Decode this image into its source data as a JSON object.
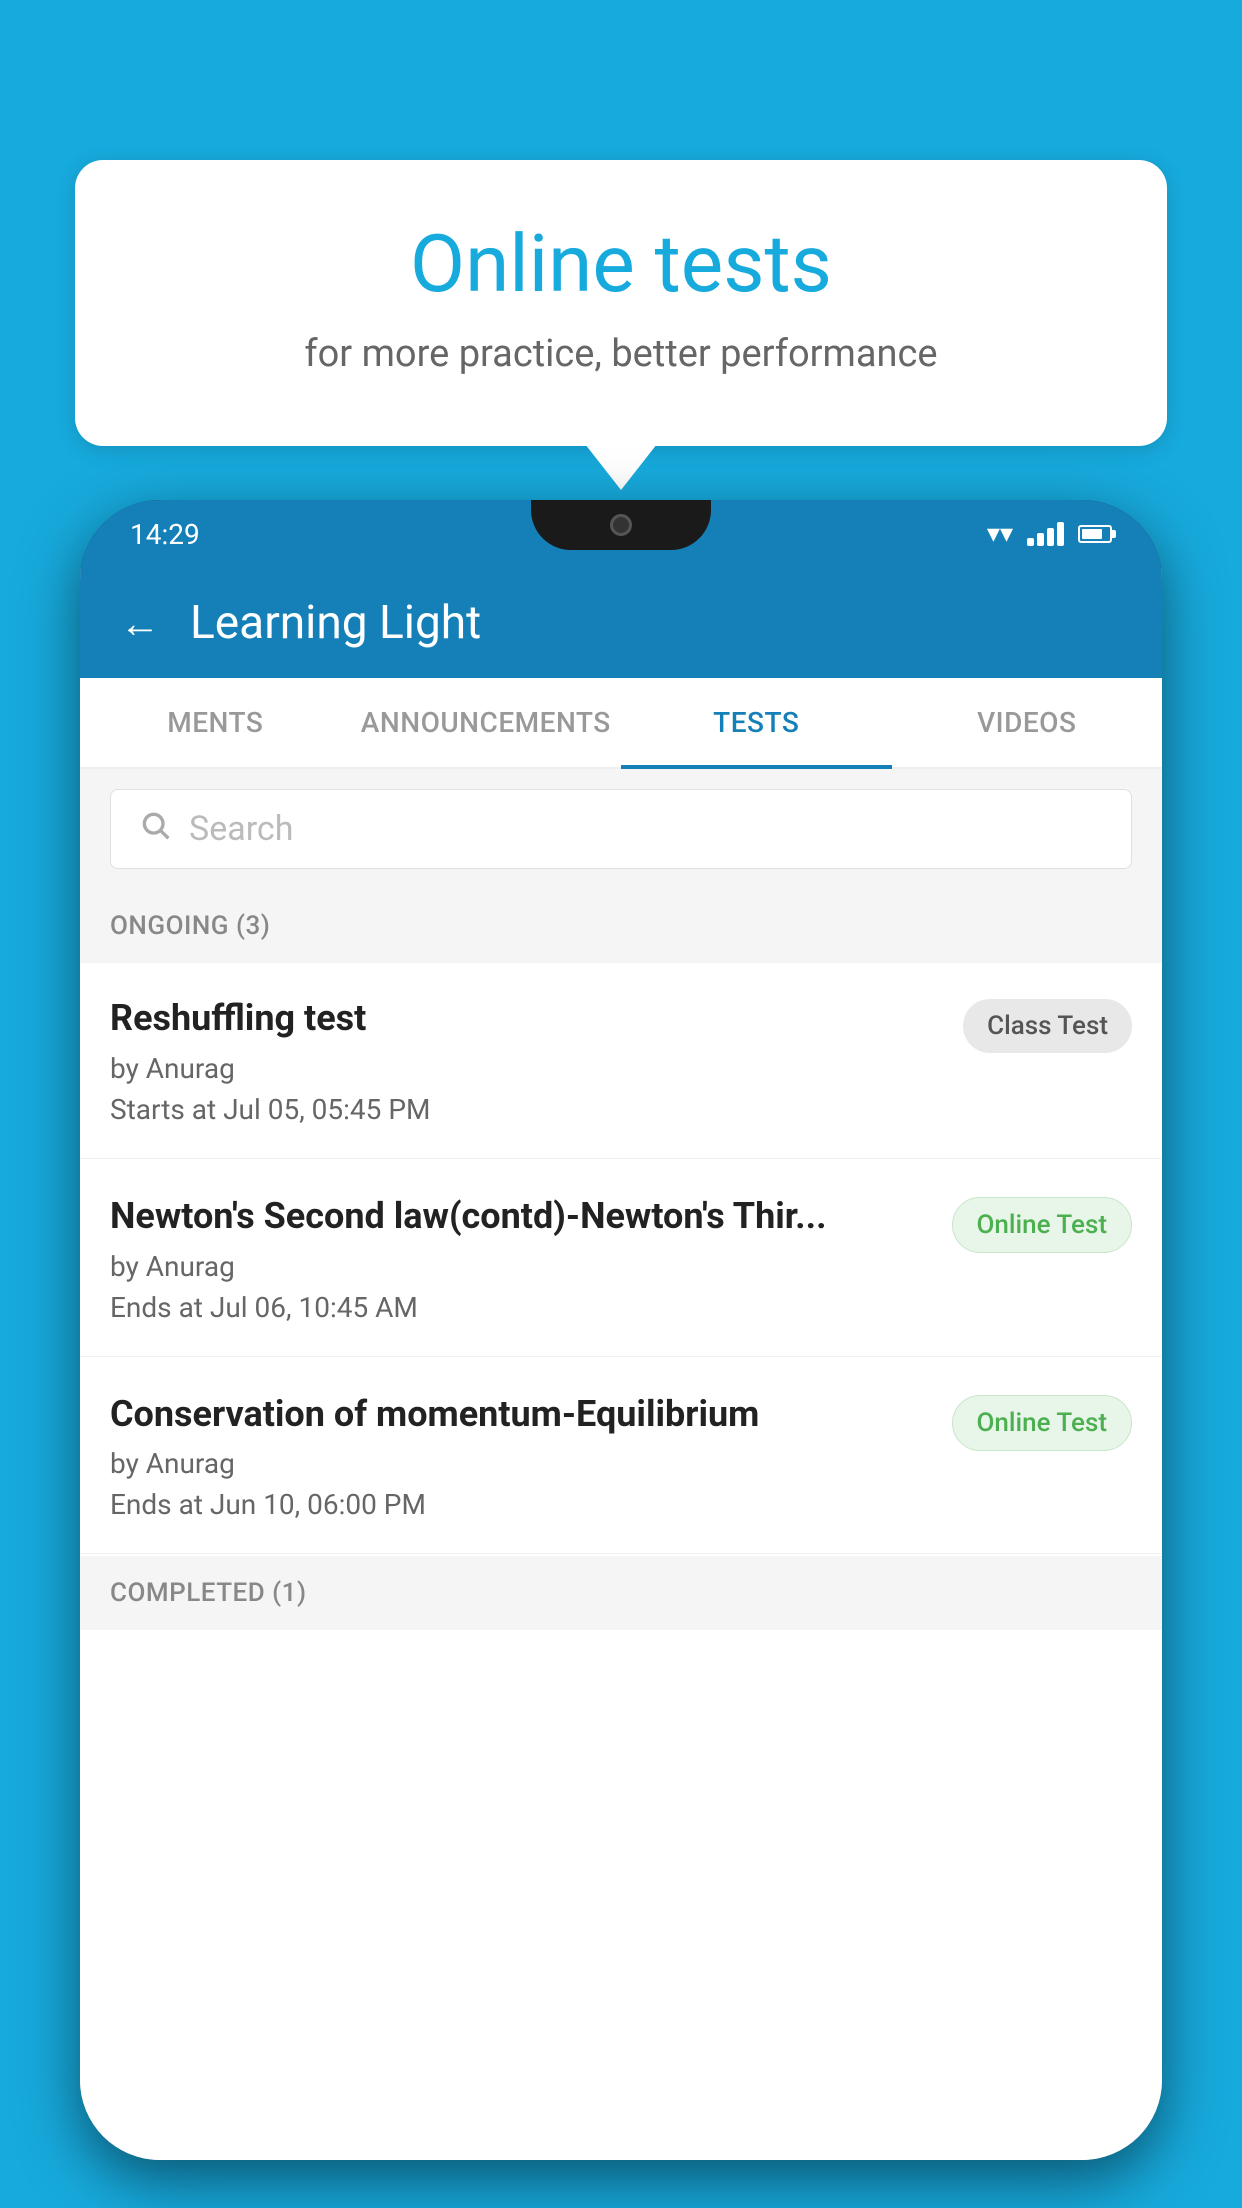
{
  "background": {
    "color": "#17AADD"
  },
  "speech_bubble": {
    "title": "Online tests",
    "subtitle": "for more practice, better performance"
  },
  "phone": {
    "status_bar": {
      "time": "14:29",
      "wifi": true,
      "signal": true,
      "battery": true
    },
    "header": {
      "back_label": "←",
      "title": "Learning Light"
    },
    "tabs": [
      {
        "label": "MENTS",
        "active": false
      },
      {
        "label": "ANNOUNCEMENTS",
        "active": false
      },
      {
        "label": "TESTS",
        "active": true
      },
      {
        "label": "VIDEOS",
        "active": false
      }
    ],
    "search": {
      "placeholder": "Search"
    },
    "section_ongoing": {
      "label": "ONGOING (3)"
    },
    "tests": [
      {
        "title": "Reshuffling test",
        "by": "by Anurag",
        "time": "Starts at  Jul 05, 05:45 PM",
        "badge": "Class Test",
        "badge_type": "class"
      },
      {
        "title": "Newton's Second law(contd)-Newton's Thir...",
        "by": "by Anurag",
        "time": "Ends at  Jul 06, 10:45 AM",
        "badge": "Online Test",
        "badge_type": "online"
      },
      {
        "title": "Conservation of momentum-Equilibrium",
        "by": "by Anurag",
        "time": "Ends at  Jun 10, 06:00 PM",
        "badge": "Online Test",
        "badge_type": "online"
      }
    ],
    "section_completed": {
      "label": "COMPLETED (1)"
    }
  }
}
